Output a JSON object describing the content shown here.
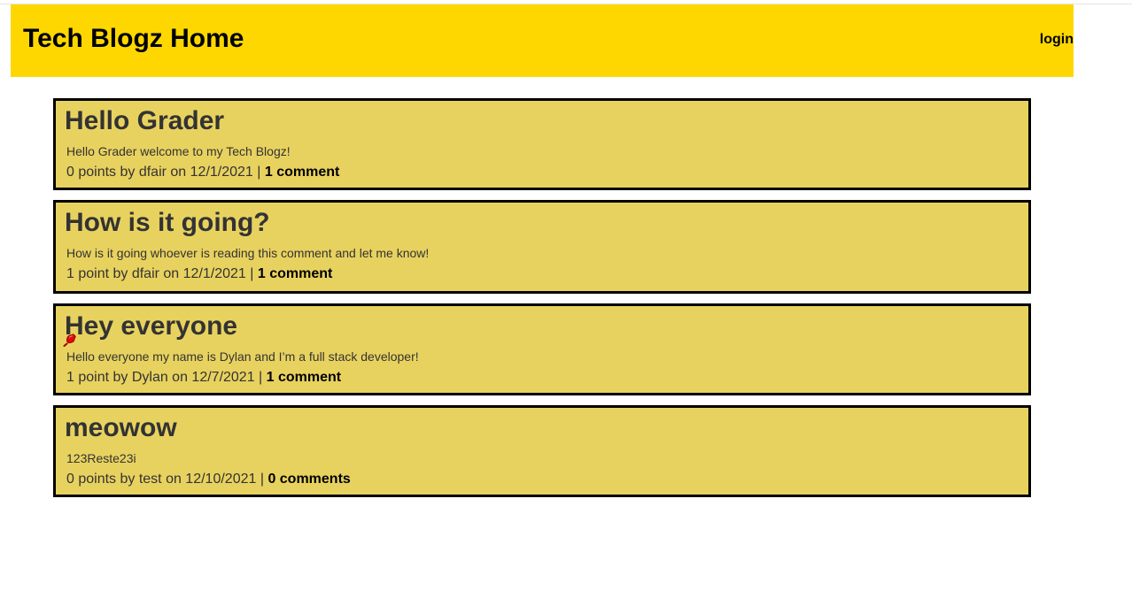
{
  "header": {
    "title": "Tech Blogz Home",
    "login_label": "login",
    "background_color": "#ffd700"
  },
  "posts": [
    {
      "title": "Hello Grader",
      "body": "Hello Grader welcome to my Tech Blogz!",
      "meta": "0 points by dfair on 12/1/2021 | ",
      "comments_label": "1 comment"
    },
    {
      "title": "How is it going?",
      "body": "How is it going whoever is reading this comment and let me know!",
      "meta": "1 point by dfair on 12/1/2021 | ",
      "comments_label": "1 comment"
    },
    {
      "title": "Hey everyone",
      "body": "Hello everyone my name is Dylan and I’m a full stack developer!",
      "meta": "1 point by Dylan on 12/7/2021 | ",
      "comments_label": "1 comment",
      "icon": "red-pin-icon"
    },
    {
      "title": "meowow",
      "body": "123Reste23i",
      "meta": "0 points by test on 12/10/2021 | ",
      "comments_label": "0 comments"
    }
  ],
  "colors": {
    "post_background": "#e8d25f",
    "post_border": "#000000",
    "text": "#333333"
  }
}
